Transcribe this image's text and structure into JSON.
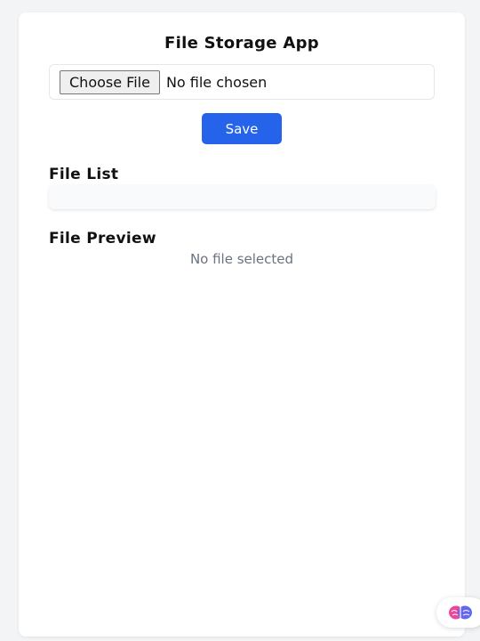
{
  "app": {
    "title": "File Storage App"
  },
  "upload": {
    "choose_file_label": "Choose File",
    "no_file_text": "No file chosen",
    "save_label": "Save"
  },
  "file_list": {
    "heading": "File List",
    "items": []
  },
  "preview": {
    "heading": "File Preview",
    "empty_text": "No file selected"
  },
  "colors": {
    "accent": "#2563eb",
    "page_background": "#f3f4f6",
    "card_background": "#ffffff",
    "muted_text": "#6b7280"
  },
  "icons": {
    "assistant": "brain-icon"
  }
}
